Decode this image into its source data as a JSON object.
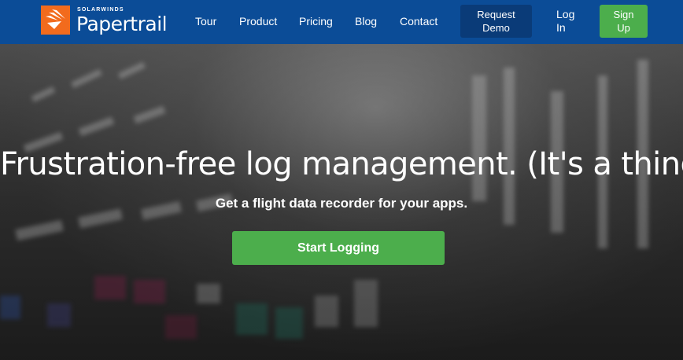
{
  "brand": {
    "vendor": "SOLARWINDS",
    "product": "Papertrail",
    "logo_icon": "solarwinds-flame-icon",
    "logo_color": "#f26b1d"
  },
  "nav": {
    "links": [
      "Tour",
      "Product",
      "Pricing",
      "Blog",
      "Contact"
    ],
    "request_demo_line1": "Request",
    "request_demo_line2": "Demo",
    "login_line1": "Log",
    "login_line2": "In",
    "signup_line1": "Sign",
    "signup_line2": "Up",
    "bg_color": "#0b4c97"
  },
  "hero": {
    "headline": "Frustration-free log management. (It's a thing.)",
    "subheadline": "Get a flight data recorder for your apps.",
    "cta_label": "Start Logging",
    "cta_color": "#4cae4c"
  }
}
